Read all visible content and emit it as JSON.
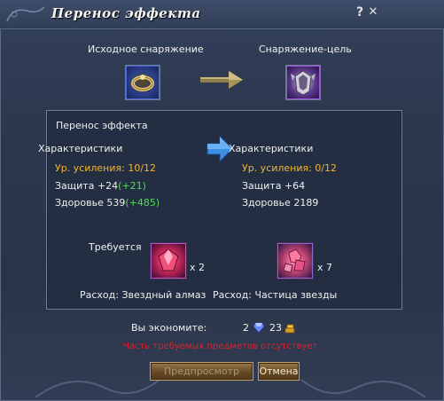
{
  "window": {
    "title": "Перенос эффекта",
    "help_icon": "?",
    "close_icon": "✕"
  },
  "top": {
    "source_label": "Исходное снаряжение",
    "target_label": "Снаряжение-цель"
  },
  "panel": {
    "title": "Перенос эффекта",
    "left": {
      "header": "Характеристики",
      "enhance": "Ур. усиления: 10/12",
      "defense_base": "Защита +24",
      "defense_bonus": "(+21)",
      "health_base": "Здоровье 539",
      "health_bonus": "(+485)"
    },
    "right": {
      "header": "Характеристики",
      "enhance": "Ур. усиления: 0/12",
      "defense": "Защита +64",
      "health": "Здоровье 2189"
    },
    "required_label": "Требуется",
    "mat1": {
      "qty": "x  2",
      "cost": "Расход: Звездный алмаз"
    },
    "mat2": {
      "qty": "x  7",
      "cost": "Расход: Частица звезды"
    }
  },
  "savings": {
    "label": "Вы экономите:",
    "gems": "2",
    "gold": "23"
  },
  "warning": "Часть требуемых предметов отсутствует.",
  "buttons": {
    "preview": "Предпросмотр",
    "cancel": "Отмена"
  },
  "colors": {
    "gold_text": "#f2b632",
    "green_text": "#4ee04e",
    "warning_red": "#e0202a"
  }
}
